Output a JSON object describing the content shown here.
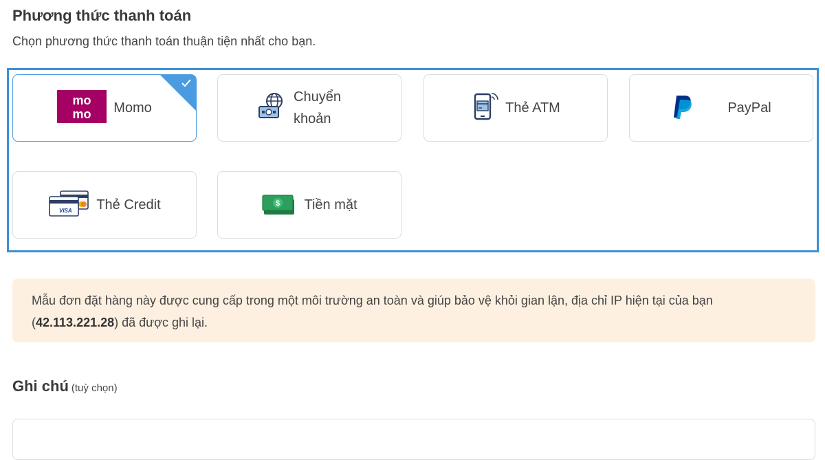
{
  "header": {
    "title": "Phương thức thanh toán",
    "subtitle": "Chọn phương thức thanh toán thuận tiện nhất cho bạn."
  },
  "payment_methods": [
    {
      "label": "Momo",
      "icon": "momo-logo-icon",
      "selected": true
    },
    {
      "label": "Chuyển khoản",
      "icon": "bank-transfer-icon",
      "selected": false
    },
    {
      "label": "Thẻ ATM",
      "icon": "atm-card-icon",
      "selected": false
    },
    {
      "label": "PayPal",
      "icon": "paypal-logo-icon",
      "selected": false
    },
    {
      "label": "Thẻ Credit",
      "icon": "credit-card-icon",
      "selected": false
    },
    {
      "label": "Tiền mặt",
      "icon": "cash-icon",
      "selected": false
    }
  ],
  "momo_logo_text": [
    "mo",
    "mo"
  ],
  "notice": {
    "before": "Mẫu đơn đặt hàng này được cung cấp trong một môi trường an toàn và giúp bảo vệ khỏi gian lận, địa chỉ IP hiện tại của bạn (",
    "ip": "42.113.221.28",
    "after": ") đã được ghi lại."
  },
  "note": {
    "label": "Ghi chú",
    "hint": "(tuỳ chọn)",
    "value": ""
  },
  "colors": {
    "accent": "#3b8fd6",
    "momo": "#a50064",
    "notice_bg": "#fdf0e0",
    "cash": "#2e9e5b",
    "paypal_dark": "#003087",
    "paypal_light": "#009cde"
  }
}
